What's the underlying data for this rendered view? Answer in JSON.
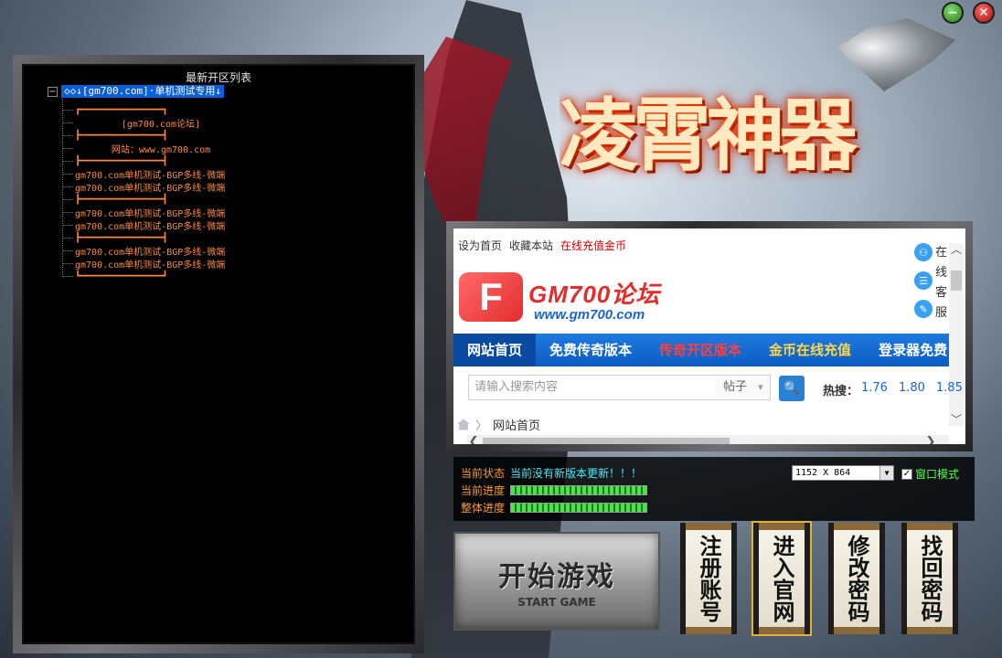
{
  "window": {
    "minimize_label": "−",
    "close_label": "✕"
  },
  "logo": {
    "title": "凌霄神器"
  },
  "server_list": {
    "title": "最新开区列表",
    "root_label": "◇◇↓[gm700.com]·单机测试专用↓",
    "expander": "−",
    "items": [
      {
        "text": "┏━━━━━━━━━━━━━━━━━━┓",
        "type": "sep"
      },
      {
        "text": "[gm700.com论坛]",
        "type": "center"
      },
      {
        "text": "┣━━━━━━━━━━━━━━━━━━┫",
        "type": "sep"
      },
      {
        "text": "网站：www.gm700.com",
        "type": "center"
      },
      {
        "text": "┣━━━━━━━━━━━━━━━━━━┫",
        "type": "sep"
      },
      {
        "text": "gm700.com单机测试-BGP多线-微端",
        "type": "item"
      },
      {
        "text": "gm700.com单机测试-BGP多线-微端",
        "type": "item"
      },
      {
        "text": "┣━━━━━━━━━━━━━━━━━━┫",
        "type": "sep"
      },
      {
        "text": "gm700.com单机测试-BGP多线-微端",
        "type": "item"
      },
      {
        "text": "gm700.com单机测试-BGP多线-微端",
        "type": "item"
      },
      {
        "text": "┣━━━━━━━━━━━━━━━━━━┫",
        "type": "sep"
      },
      {
        "text": "gm700.com单机测试-BGP多线-微端",
        "type": "item"
      },
      {
        "text": "gm700.com单机测试-BGP多线-微端",
        "type": "item"
      },
      {
        "text": "┗━━━━━━━━━━━━━━━━━━┛",
        "type": "sep"
      }
    ]
  },
  "browser": {
    "top_links": {
      "set_home": "设为首页",
      "bookmark": "收藏本站",
      "recharge": "在线充值金币"
    },
    "forum_logo_letter": "F",
    "forum_name": "GM700论坛",
    "forum_url": "www.gm700.com",
    "side_icons": [
      "⚇",
      "☰",
      "✎"
    ],
    "side_text": "在线客服",
    "nav": [
      {
        "label": "网站首页",
        "style": "active"
      },
      {
        "label": "免费传奇版本",
        "style": "normal"
      },
      {
        "label": "传奇开区版本",
        "style": "red"
      },
      {
        "label": "金币在线充值",
        "style": "yellow"
      },
      {
        "label": "登录器免费",
        "style": "normal"
      }
    ],
    "search": {
      "placeholder": "请输入搜索内容",
      "type": "帖子",
      "type_arrow": "▾",
      "button": "🔍"
    },
    "hot": {
      "label": "热搜：",
      "items": [
        "1.76",
        "1.80",
        "1.85"
      ]
    },
    "breadcrumb": {
      "separator": "〉",
      "current": "网站首页"
    },
    "scroll": {
      "up": "︿",
      "down": "﹀",
      "left": "❮",
      "right": "❯"
    }
  },
  "status": {
    "state_label": "当前状态",
    "state_text": "当前没有新版本更新！！！",
    "current_label": "当前进度",
    "overall_label": "整体进度",
    "current_progress": 1.0,
    "overall_progress": 1.0,
    "resolution": "1152 X 864",
    "resolution_arrow": "▼",
    "window_mode_checked": "✓",
    "window_mode_label": "窗口模式"
  },
  "buttons": {
    "start_cn": "开始游戏",
    "start_en": "START GAME",
    "register": "注册账号",
    "official": "进入官网",
    "change_pwd": "修改密码",
    "recover_pwd": "找回密码"
  }
}
